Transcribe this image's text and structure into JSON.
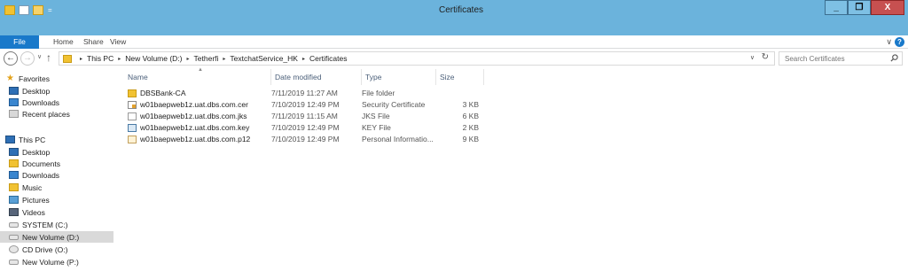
{
  "window": {
    "title": "Certificates",
    "buttons": {
      "minimize": "_",
      "maximize": "❐",
      "close": "X"
    },
    "qat_dropdown": "="
  },
  "ribbon": {
    "tabs": [
      "File",
      "Home",
      "Share",
      "View"
    ],
    "collapse_glyph": "∨",
    "help_glyph": "?"
  },
  "address": {
    "back_glyph": "←",
    "forward_glyph": "→",
    "up_glyph": "↑",
    "breadcrumb": [
      "This PC",
      "New Volume (D:)",
      "Tetherfi",
      "TextchatService_HK",
      "Certificates"
    ],
    "separator": "▸",
    "dropdown_glyph": "∨",
    "refresh_glyph": "↻"
  },
  "search": {
    "placeholder": "Search Certificates"
  },
  "navpane": {
    "favorites": {
      "label": "Favorites",
      "items": [
        "Desktop",
        "Downloads",
        "Recent places"
      ]
    },
    "thispc": {
      "label": "This PC",
      "items": [
        "Desktop",
        "Documents",
        "Downloads",
        "Music",
        "Pictures",
        "Videos",
        "SYSTEM (C:)",
        "New Volume (D:)",
        "CD Drive (O:)",
        "New Volume (P:)"
      ]
    },
    "selected": "New Volume (D:)"
  },
  "filelist": {
    "columns": {
      "name": "Name",
      "date": "Date modified",
      "type": "Type",
      "size": "Size"
    },
    "sort_glyph": "▲",
    "rows": [
      {
        "icon": "folder-icon",
        "name": "DBSBank-CA",
        "date": "7/11/2019 11:27 AM",
        "type": "File folder",
        "size": ""
      },
      {
        "icon": "certificate-icon",
        "name": "w01baepweb1z.uat.dbs.com.cer",
        "date": "7/10/2019 12:49 PM",
        "type": "Security Certificate",
        "size": "3 KB"
      },
      {
        "icon": "document-icon",
        "name": "w01baepweb1z.uat.dbs.com.jks",
        "date": "7/11/2019 11:15 AM",
        "type": "JKS File",
        "size": "6 KB"
      },
      {
        "icon": "key-file-icon",
        "name": "w01baepweb1z.uat.dbs.com.key",
        "date": "7/10/2019 12:49 PM",
        "type": "KEY File",
        "size": "2 KB"
      },
      {
        "icon": "personal-info-icon",
        "name": "w01baepweb1z.uat.dbs.com.p12",
        "date": "7/10/2019 12:49 PM",
        "type": "Personal Informatio...",
        "size": "9 KB"
      }
    ]
  }
}
